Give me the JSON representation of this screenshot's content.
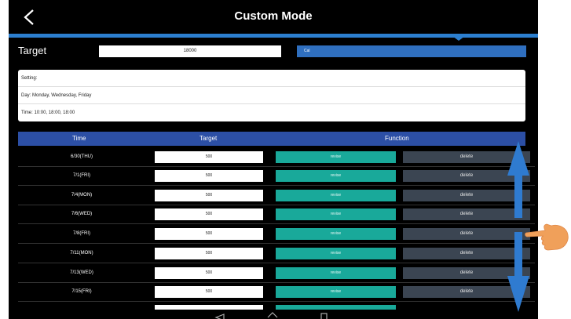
{
  "header": {
    "title": "Custom Mode"
  },
  "target": {
    "label": "Target",
    "value": "18000",
    "cal_label": "Cal"
  },
  "setting": {
    "label": "Setting:",
    "day": "Day: Monday, Wednesday, Friday",
    "time": "Time: 10:00, 18:00, 18:00"
  },
  "table": {
    "headers": {
      "time": "Time",
      "target": "Target",
      "function": "Function"
    },
    "rows": [
      {
        "time": "6/30(THU)",
        "target": "500",
        "revise": "revise",
        "delete": "delete"
      },
      {
        "time": "7/1(FRI)",
        "target": "500",
        "revise": "revise",
        "delete": "delete"
      },
      {
        "time": "7/4(MON)",
        "target": "500",
        "revise": "revise",
        "delete": "delete"
      },
      {
        "time": "7/6(WED)",
        "target": "500",
        "revise": "revise",
        "delete": "delete"
      },
      {
        "time": "7/8(FRI)",
        "target": "500",
        "revise": "revise",
        "delete": "delete"
      },
      {
        "time": "7/11(MON)",
        "target": "500",
        "revise": "revise",
        "delete": "delete"
      },
      {
        "time": "7/13(WED)",
        "target": "500",
        "revise": "revise",
        "delete": "delete"
      },
      {
        "time": "7/15(FRI)",
        "target": "500",
        "revise": "revise",
        "delete": "delete"
      }
    ]
  },
  "icons": {
    "back": "chevron-left-icon",
    "nav_back": "triangle-back-icon",
    "nav_home": "home-icon",
    "nav_recent": "square-recent-icon",
    "scroll_up": "arrow-up-icon",
    "scroll_down": "arrow-down-icon",
    "hand": "pointing-hand-icon"
  },
  "colors": {
    "background": "#000000",
    "accent_blue": "#2c7fcf",
    "table_header": "#2c4fa5",
    "revise": "#19a99a",
    "delete": "#3b4552"
  }
}
